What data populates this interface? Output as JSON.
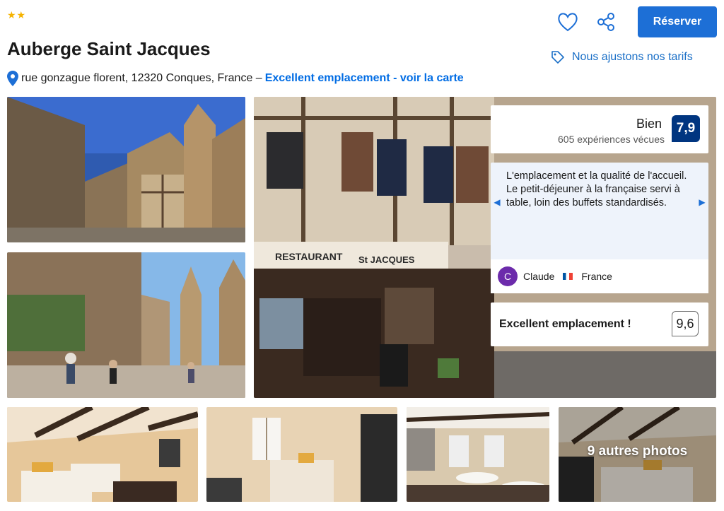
{
  "header": {
    "stars": "★★",
    "hotel_name": "Auberge Saint Jacques",
    "address": "rue gonzague florent, 12320 Conques, France –",
    "location_link": "Excellent emplacement - voir la carte",
    "reserve_label": "Réserver",
    "price_match": "Nous ajustons nos tarifs"
  },
  "review": {
    "label": "Bien",
    "count": "605 expériences vécues",
    "score": "7,9"
  },
  "quote": {
    "text": "L'emplacement et la qualité de l'accueil. Le petit-déjeuner à la française servi à table, loin des buffets standardisés.",
    "author_initial": "C",
    "author": "Claude",
    "country": "France"
  },
  "location": {
    "label": "Excellent emplacement !",
    "score": "9,6"
  },
  "gallery": {
    "more_photos": "9 autres photos",
    "sign_restaurant": "RESTAURANT",
    "sign_name": "St JACQUES"
  },
  "colors": {
    "accent": "#1d6fd6",
    "score_bg": "#003580",
    "star": "#f5b301"
  }
}
